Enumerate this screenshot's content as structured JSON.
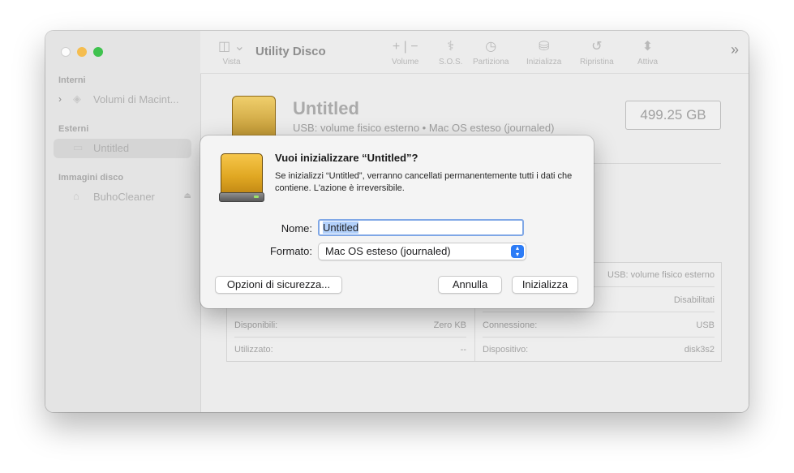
{
  "window": {
    "title": "Utility Disco"
  },
  "sidebar": {
    "sections": {
      "internal": "Interni",
      "external": "Esterni",
      "images": "Immagini disco"
    },
    "items": [
      {
        "label": "Volumi di Macint..."
      },
      {
        "label": "Untitled"
      },
      {
        "label": "BuhoCleaner"
      }
    ]
  },
  "toolbar": {
    "view_label": "Vista",
    "volume_label": "Volume",
    "sos_label": "S.O.S.",
    "partition_label": "Partiziona",
    "erase_label": "Inizializza",
    "restore_label": "Ripristina",
    "mount_label": "Attiva"
  },
  "volume": {
    "name": "Untitled",
    "description": "USB: volume fisico esterno • Mac OS esteso (journaled)",
    "capacity": "499.25 GB"
  },
  "info": {
    "left": [
      {
        "key": "Disponibili:",
        "value": "Zero KB"
      },
      {
        "key": "Utilizzato:",
        "value": "--"
      }
    ],
    "right": [
      {
        "key": "",
        "value": "USB: volume fisico esterno"
      },
      {
        "key": "",
        "value": "Disabilitati"
      },
      {
        "key": "Connessione:",
        "value": "USB"
      },
      {
        "key": "Dispositivo:",
        "value": "disk3s2"
      }
    ]
  },
  "dialog": {
    "title": "Vuoi inizializzare “Untitled”?",
    "message": "Se inizializzi “Untitled”, verranno cancellati permanentemente tutti i dati che contiene. L'azione è irreversibile.",
    "name_label": "Nome:",
    "name_value": "Untitled",
    "format_label": "Formato:",
    "format_value": "Mac OS esteso (journaled)",
    "security_button": "Opzioni di sicurezza...",
    "cancel_button": "Annulla",
    "erase_button": "Inizializza"
  },
  "colors": {
    "accent": "#2d7cf6",
    "drive": "#e0a722"
  },
  "icons": [
    "sidebar-toggle-icon",
    "add-icon",
    "remove-icon",
    "first-aid-icon",
    "partition-icon",
    "erase-icon",
    "restore-icon",
    "mount-icon",
    "more-icon",
    "volume-stack-icon",
    "external-drive-icon",
    "disk-image-icon",
    "eject-icon",
    "popup-arrows-icon"
  ]
}
